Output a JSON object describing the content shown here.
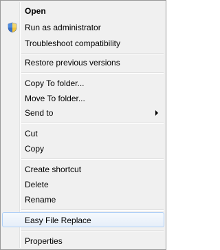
{
  "menu": {
    "items": {
      "open": "Open",
      "run_as_admin": "Run as administrator",
      "troubleshoot": "Troubleshoot compatibility",
      "restore": "Restore previous versions",
      "copy_to": "Copy To folder...",
      "move_to": "Move To folder...",
      "send_to": "Send to",
      "cut": "Cut",
      "copy": "Copy",
      "create_shortcut": "Create shortcut",
      "delete": "Delete",
      "rename": "Rename",
      "easy_file_replace": "Easy File Replace",
      "properties": "Properties"
    },
    "icons": {
      "run_as_admin": "uac-shield-icon",
      "send_to": "submenu-arrow-icon"
    },
    "colors": {
      "background": "#f0f0f0",
      "border": "#979797",
      "highlight_border": "#aecff7",
      "highlight_fill": "#e6eef9"
    }
  }
}
